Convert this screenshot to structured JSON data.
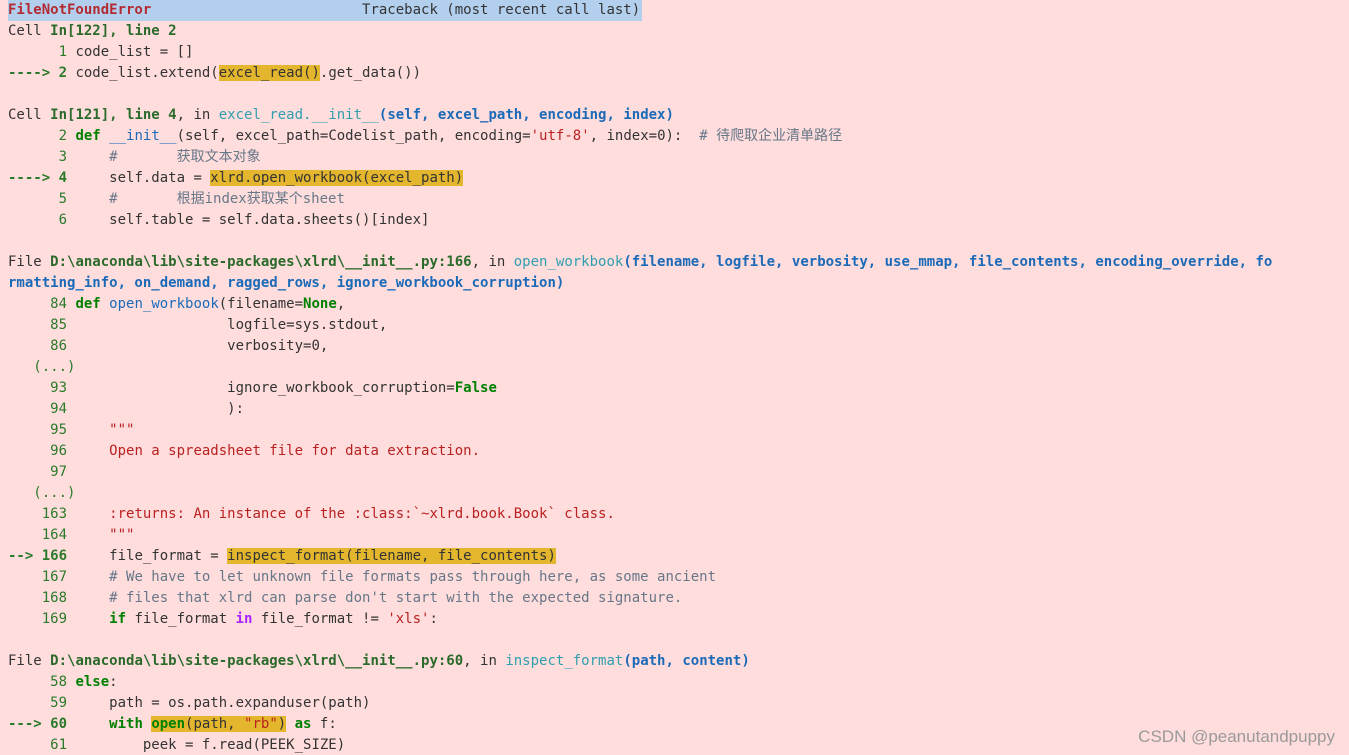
{
  "header": {
    "error_type": "FileNotFoundError",
    "traceback_label": "Traceback (most recent call last)"
  },
  "frame1": {
    "file_prefix": "Cell ",
    "cell_ref": "In[122], line 2",
    "lines": [
      {
        "marker": "      1 ",
        "code": "code_list = []"
      },
      {
        "marker": "----> 2 ",
        "code_pre": "code_list.extend(",
        "code_hl": "excel_read()",
        "code_post": ".get_data())"
      }
    ]
  },
  "frame2": {
    "file_prefix": "Cell ",
    "cell_ref": "In[121], line 4",
    "in_label": ", in ",
    "func": "excel_read.__init__",
    "args": "(self, excel_path, encoding, index)",
    "lines": [
      {
        "marker": "      2 ",
        "kw": "def",
        "code_fn": "__init__",
        "code_rest": "(self, excel_path=Codelist_path, encoding=",
        "str": "'utf-8'",
        "code_rest2": ", index=0):  ",
        "comment": "# 待爬取企业清单路径"
      },
      {
        "marker": "      3 ",
        "comment": "    #       获取文本对象"
      },
      {
        "marker": "----> 4 ",
        "code_pre": "    self.data = ",
        "code_hl": "xlrd.open_workbook(excel_path)"
      },
      {
        "marker": "      5 ",
        "comment": "    #       根据index获取某个sheet"
      },
      {
        "marker": "      6 ",
        "code": "    self.table = self.data.sheets()[index]"
      }
    ]
  },
  "frame3": {
    "file_prefix": "File ",
    "path": "D:\\anaconda\\lib\\site-packages\\xlrd\\__init__.py:166",
    "in_label": ", in ",
    "func": "open_workbook",
    "args_line1": "(filename, logfile, verbosity, use_mmap, file_contents, encoding_override, fo",
    "args_line2": "rmatting_info, on_demand, ragged_rows, ignore_workbook_corruption)",
    "lines": [
      {
        "marker": "     84 ",
        "kw": "def",
        "code_fn": "open_workbook",
        "code_rest": "(filename=",
        "kw_val": "None",
        "code_rest2": ","
      },
      {
        "marker": "     85 ",
        "code": "                  logfile=sys.stdout,"
      },
      {
        "marker": "     86 ",
        "code": "                  verbosity=0,"
      },
      {
        "ellipsis": "   (...)"
      },
      {
        "marker": "     93 ",
        "code_rest": "                  ignore_workbook_corruption=",
        "kw_val": "False"
      },
      {
        "marker": "     94 ",
        "code": "                  ):"
      },
      {
        "marker": "     95 ",
        "doc": "    \"\"\""
      },
      {
        "marker": "     96 ",
        "doc": "    Open a spreadsheet file for data extraction."
      },
      {
        "marker": "     97 ",
        "doc": ""
      },
      {
        "ellipsis": "   (...)"
      },
      {
        "marker": "    163 ",
        "doc": "    :returns: An instance of the :class:`~xlrd.book.Book` class."
      },
      {
        "marker": "    164 ",
        "doc": "    \"\"\""
      },
      {
        "marker": "--> 166 ",
        "code_pre": "    file_format = ",
        "code_hl": "inspect_format(filename, file_contents)"
      },
      {
        "marker": "    167 ",
        "comment": "    # We have to let unknown file formats pass through here, as some ancient"
      },
      {
        "marker": "    168 ",
        "comment": "    # files that xlrd can parse don't start with the expected signature."
      },
      {
        "marker": "    169 ",
        "kw": "    if",
        "code_mid": " file_format != ",
        "str": "'xls'",
        "code_end": ":",
        "kw_in": "in"
      }
    ]
  },
  "frame4": {
    "file_prefix": "File ",
    "path": "D:\\anaconda\\lib\\site-packages\\xlrd\\__init__.py:60",
    "in_label": ", in ",
    "func": "inspect_format",
    "args": "(path, content)",
    "lines": [
      {
        "marker": "     58 ",
        "kw": "else",
        "code": ":"
      },
      {
        "marker": "     59 ",
        "code": "    path = os.path.expanduser(path)"
      },
      {
        "marker": "---> 60 ",
        "kw": "    with",
        "hl_fn": "open",
        "hl_pre": "(path, ",
        "hl_str": "\"rb\"",
        "hl_post": ")",
        "kw_as": " as",
        "code_end": " f:"
      },
      {
        "marker": "     61 ",
        "code": "        peek = f.read(PEEK_SIZE)"
      }
    ]
  },
  "watermark": "CSDN @peanutandpuppy",
  "colors": {
    "background": "#ffdddd",
    "title_highlight": "#b3cfee",
    "error_red": "#b22b31",
    "keyword_green": "#008000",
    "highlight_yellow": "#e4b62d",
    "function_blue": "#1b6ab8"
  }
}
